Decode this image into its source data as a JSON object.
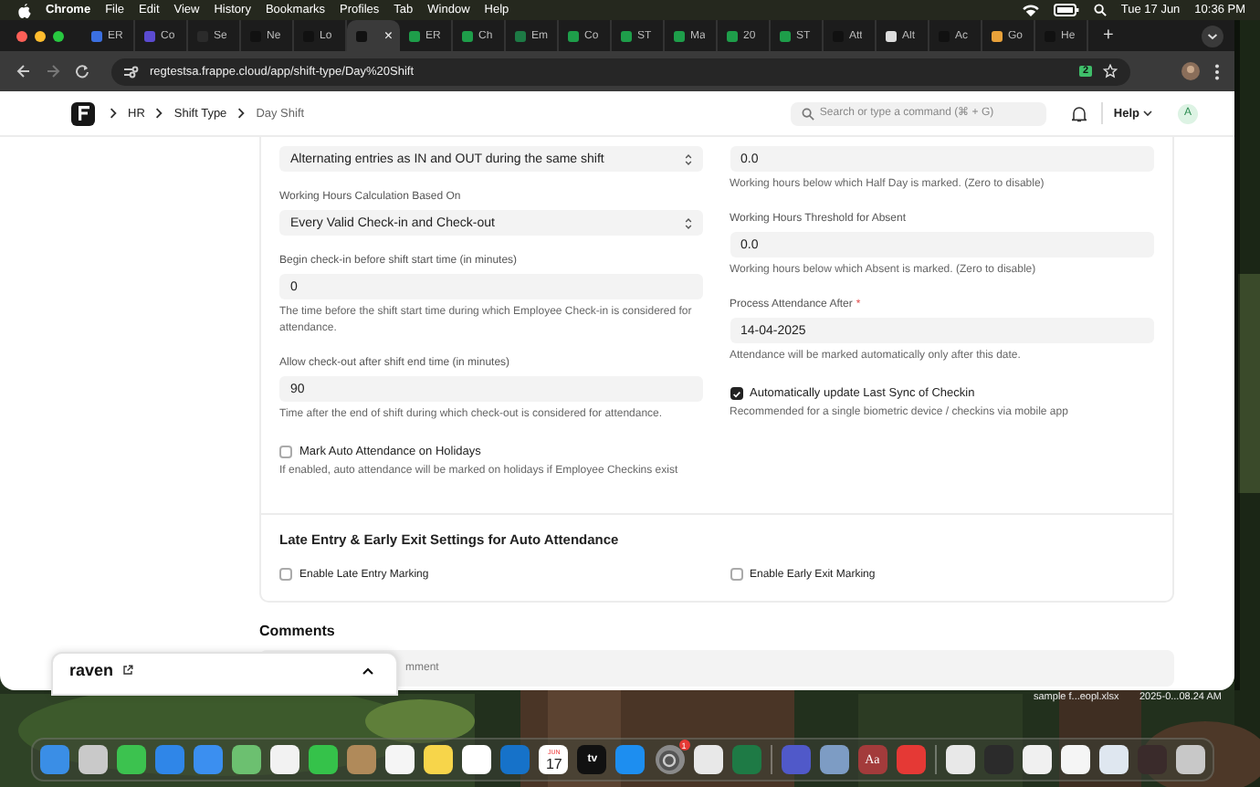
{
  "menu_bar": {
    "app": "Chrome",
    "menus": [
      "File",
      "Edit",
      "View",
      "History",
      "Bookmarks",
      "Profiles",
      "Tab",
      "Window",
      "Help"
    ],
    "date": "Tue 17 Jun",
    "time": "10:36 PM"
  },
  "tabs": [
    {
      "label": "ER",
      "selected": false
    },
    {
      "label": "Co",
      "selected": false
    },
    {
      "label": "Se",
      "selected": false
    },
    {
      "label": "Ne",
      "selected": false
    },
    {
      "label": "Lo",
      "selected": false
    },
    {
      "close": "×",
      "selected": true
    },
    {
      "label": "ER",
      "selected": false
    },
    {
      "label": "Ch",
      "selected": false
    },
    {
      "label": "Em",
      "selected": false
    },
    {
      "label": "Co",
      "selected": false
    },
    {
      "label": "ST",
      "selected": false
    },
    {
      "label": "Ma",
      "selected": false
    },
    {
      "label": "20",
      "selected": false
    },
    {
      "label": "ST",
      "selected": false
    },
    {
      "label": "Att",
      "selected": false
    },
    {
      "label": "Alt",
      "selected": false
    },
    {
      "label": "Ac",
      "selected": false
    },
    {
      "label": "Go",
      "selected": false
    },
    {
      "label": "He",
      "selected": false
    }
  ],
  "new_tab": "+",
  "address_bar": {
    "url": "regtestsa.frappe.cloud/app/shift-type/Day%20Shift",
    "extension_badge": "2"
  },
  "header": {
    "breadcrumbs": [
      "HR",
      "Shift Type",
      "Day Shift"
    ],
    "search": {
      "placeholder": "Search or type a command (⌘ + G)"
    },
    "help": "Help",
    "avatar": "A"
  },
  "form": {
    "left": [
      {
        "kind": "select",
        "value": "Alternating entries as IN and OUT during the same shift"
      },
      {
        "kind": "select",
        "label": "Working Hours Calculation Based On",
        "value": "Every Valid Check-in and Check-out"
      },
      {
        "kind": "input",
        "label": "Begin check-in before shift start time (in minutes)",
        "value": "0",
        "description": "The time before the shift start time during which Employee Check-in is considered for attendance."
      },
      {
        "kind": "input",
        "label": "Allow check-out after shift end time (in minutes)",
        "value": "90",
        "description": "Time after the end of shift during which check-out is considered for attendance."
      },
      {
        "kind": "checkbox",
        "label": "Mark Auto Attendance on Holidays",
        "checked": false,
        "description": "If enabled, auto attendance will be marked on holidays if Employee Checkins exist"
      }
    ],
    "right": [
      {
        "kind": "input",
        "value": "0.0",
        "description": "Working hours below which Half Day is marked. (Zero to disable)"
      },
      {
        "kind": "input",
        "label": "Working Hours Threshold for Absent",
        "value": "0.0",
        "description": "Working hours below which Absent is marked. (Zero to disable)"
      },
      {
        "kind": "input",
        "label": "Process Attendance After",
        "required_mark": "*",
        "value": "14-04-2025",
        "description": "Attendance will be marked automatically only after this date."
      },
      {
        "kind": "checkbox",
        "label": "Automatically update Last Sync of Checkin",
        "checked": true,
        "description": "Recommended for a single biometric device / checkins via mobile app"
      }
    ]
  },
  "section": {
    "title": "Late Entry & Early Exit Settings for Auto Attendance",
    "checkboxes": [
      {
        "label": "Enable Late Entry Marking",
        "checked": false
      },
      {
        "label": "Enable Early Exit Marking",
        "checked": false
      }
    ]
  },
  "comments": {
    "title": "Comments",
    "placeholder": "mment"
  },
  "raven": {
    "title": "raven"
  },
  "desktop_file": {
    "name": "sample f...eopl.xlsx",
    "date": "2025-0...08.24 AM"
  },
  "dock": {
    "calendar_month": "JUN",
    "calendar_day": "17",
    "tv_label": "tv",
    "settings_badge": "1",
    "dictionary_label": "Aa"
  }
}
